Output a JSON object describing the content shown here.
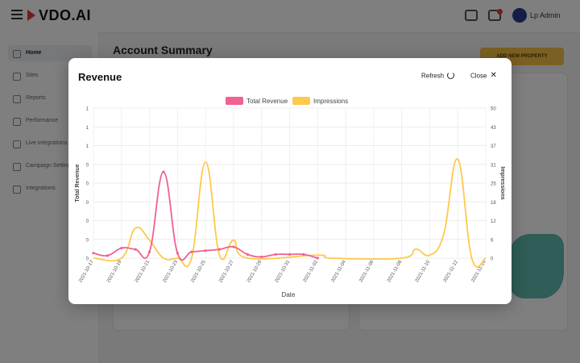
{
  "app": {
    "logo": "VDO.AI",
    "user_name": "Lp Admin",
    "page_title": "Account Summary",
    "header_button": "ADD NEW PROPERTY",
    "sidebar": [
      "Home",
      "Sites",
      "Reports",
      "Performance",
      "Live Integrations",
      "Campaign Settings",
      "Integrations"
    ]
  },
  "modal": {
    "title": "Revenue",
    "refresh_label": "Refresh",
    "close_label": "Close",
    "refresh_icon": "refresh-icon",
    "close_icon": "close-icon"
  },
  "chart_data": {
    "type": "line",
    "xlabel": "Date",
    "ylabel_left": "Total Revenue",
    "ylabel_right": "Impressions",
    "left_ticks": [
      "1",
      "1",
      "1",
      "0",
      "0",
      "0",
      "0",
      "0",
      "0"
    ],
    "right_ticks": [
      "50",
      "43",
      "37",
      "31",
      "25",
      "18",
      "12",
      "6",
      "0"
    ],
    "right_ylim": [
      0,
      50
    ],
    "x_labels": [
      "2021-10-17",
      "2021-10-19",
      "2021-10-21",
      "2021-10-23",
      "2021-10-25",
      "2021-10-27",
      "2021-10-29",
      "2021-10-31",
      "2021-11-02",
      "2021-11-04",
      "2021-11-06",
      "2021-11-08",
      "2021-11-10",
      "2021-11-12",
      "2021-11-14"
    ],
    "grid": true,
    "legend_position": "top",
    "series": [
      {
        "name": "Total Revenue",
        "color": "#f06292",
        "axis": "left",
        "points": [
          [
            "2021-10-17",
            0.04
          ],
          [
            "2021-10-18",
            0.02
          ],
          [
            "2021-10-19",
            0.08
          ],
          [
            "2021-10-20",
            0.07
          ],
          [
            "2021-10-21",
            0.05
          ],
          [
            "2021-10-22",
            0.69
          ],
          [
            "2021-10-23",
            0.04
          ],
          [
            "2021-10-24",
            0.05
          ],
          [
            "2021-10-25",
            0.06
          ],
          [
            "2021-10-26",
            0.07
          ],
          [
            "2021-10-27",
            0.09
          ],
          [
            "2021-10-28",
            0.03
          ],
          [
            "2021-10-29",
            0.01
          ],
          [
            "2021-10-30",
            0.03
          ],
          [
            "2021-10-31",
            0.03
          ],
          [
            "2021-11-01",
            0.03
          ],
          [
            "2021-11-02",
            0.0
          ]
        ]
      },
      {
        "name": "Impressions",
        "color": "#ffc94a",
        "axis": "right",
        "points": [
          [
            "2021-10-17",
            0
          ],
          [
            "2021-10-19",
            0
          ],
          [
            "2021-10-20",
            10
          ],
          [
            "2021-10-21",
            6
          ],
          [
            "2021-10-22",
            0
          ],
          [
            "2021-10-23",
            0
          ],
          [
            "2021-10-24",
            0
          ],
          [
            "2021-10-25",
            32
          ],
          [
            "2021-10-26",
            1
          ],
          [
            "2021-10-27",
            6
          ],
          [
            "2021-10-28",
            0
          ],
          [
            "2021-11-02",
            1
          ],
          [
            "2021-11-03",
            0
          ],
          [
            "2021-11-08",
            0
          ],
          [
            "2021-11-09",
            3
          ],
          [
            "2021-11-10",
            1
          ],
          [
            "2021-11-11",
            8
          ],
          [
            "2021-11-12",
            33
          ],
          [
            "2021-11-13",
            0
          ],
          [
            "2021-11-14",
            0
          ]
        ]
      }
    ]
  }
}
